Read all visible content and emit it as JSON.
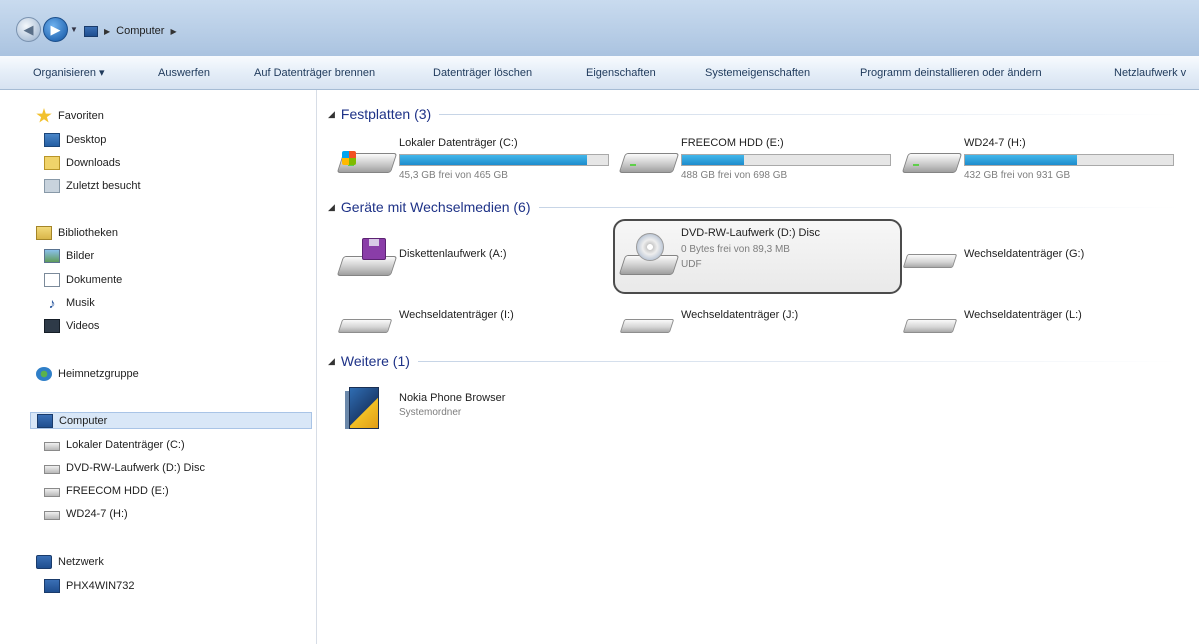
{
  "address_bar": {
    "breadcrumb": "Computer"
  },
  "toolbar": {
    "items": [
      "Organisieren ▾",
      "Auswerfen",
      "Auf Datenträger brennen",
      "Datenträger löschen",
      "Eigenschaften",
      "Systemeigenschaften",
      "Programm deinstallieren oder ändern",
      "Netzlaufwerk v"
    ]
  },
  "sidebar": {
    "favorites": {
      "label": "Favoriten",
      "items": [
        "Desktop",
        "Downloads",
        "Zuletzt besucht"
      ]
    },
    "libraries": {
      "label": "Bibliotheken",
      "items": [
        "Bilder",
        "Dokumente",
        "Musik",
        "Videos"
      ]
    },
    "homegroup": "Heimnetzgruppe",
    "computer": {
      "label": "Computer",
      "items": [
        "Lokaler Datenträger (C:)",
        "DVD-RW-Laufwerk (D:) Disc",
        "FREECOM HDD (E:)",
        "WD24-7 (H:)"
      ]
    },
    "network": {
      "label": "Netzwerk",
      "items": [
        "PHX4WIN732"
      ]
    }
  },
  "groups": {
    "hard_disks": {
      "header": "Festplatten (3)",
      "drives": [
        {
          "name": "Lokaler Datenträger (C:)",
          "free": "45,3 GB frei von 465 GB",
          "used_fraction": 0.9
        },
        {
          "name": "FREECOM HDD (E:)",
          "free": "488 GB frei von 698 GB",
          "used_fraction": 0.3
        },
        {
          "name": "WD24-7 (H:)",
          "free": "432 GB frei von 931 GB",
          "used_fraction": 0.54
        }
      ]
    },
    "removable": {
      "header": "Geräte mit Wechselmedien (6)",
      "devices": [
        {
          "name": "Diskettenlaufwerk (A:)"
        },
        {
          "name": "DVD-RW-Laufwerk (D:) Disc",
          "free": "0 Bytes frei von 89,3 MB",
          "fs": "UDF"
        },
        {
          "name": "Wechseldatenträger (G:)"
        },
        {
          "name": "Wechseldatenträger (I:)"
        },
        {
          "name": "Wechseldatenträger (J:)"
        },
        {
          "name": "Wechseldatenträger (L:)"
        }
      ]
    },
    "other": {
      "header": "Weitere (1)",
      "items": [
        {
          "name": "Nokia Phone Browser",
          "type": "Systemordner"
        }
      ]
    }
  }
}
